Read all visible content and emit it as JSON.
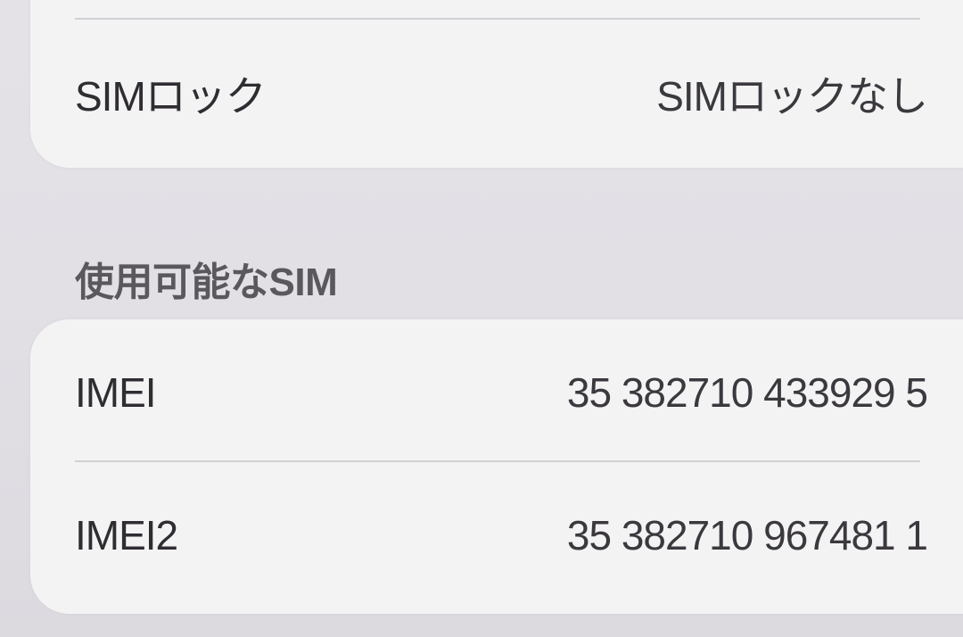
{
  "top_group": {
    "sim_lock": {
      "label": "SIMロック",
      "value": "SIMロックなし"
    }
  },
  "available_sim": {
    "header": "使用可能なSIM",
    "rows": [
      {
        "label": "IMEI",
        "value": "35 382710 433929 5"
      },
      {
        "label": "IMEI2",
        "value": "35 382710 967481 1"
      }
    ]
  }
}
